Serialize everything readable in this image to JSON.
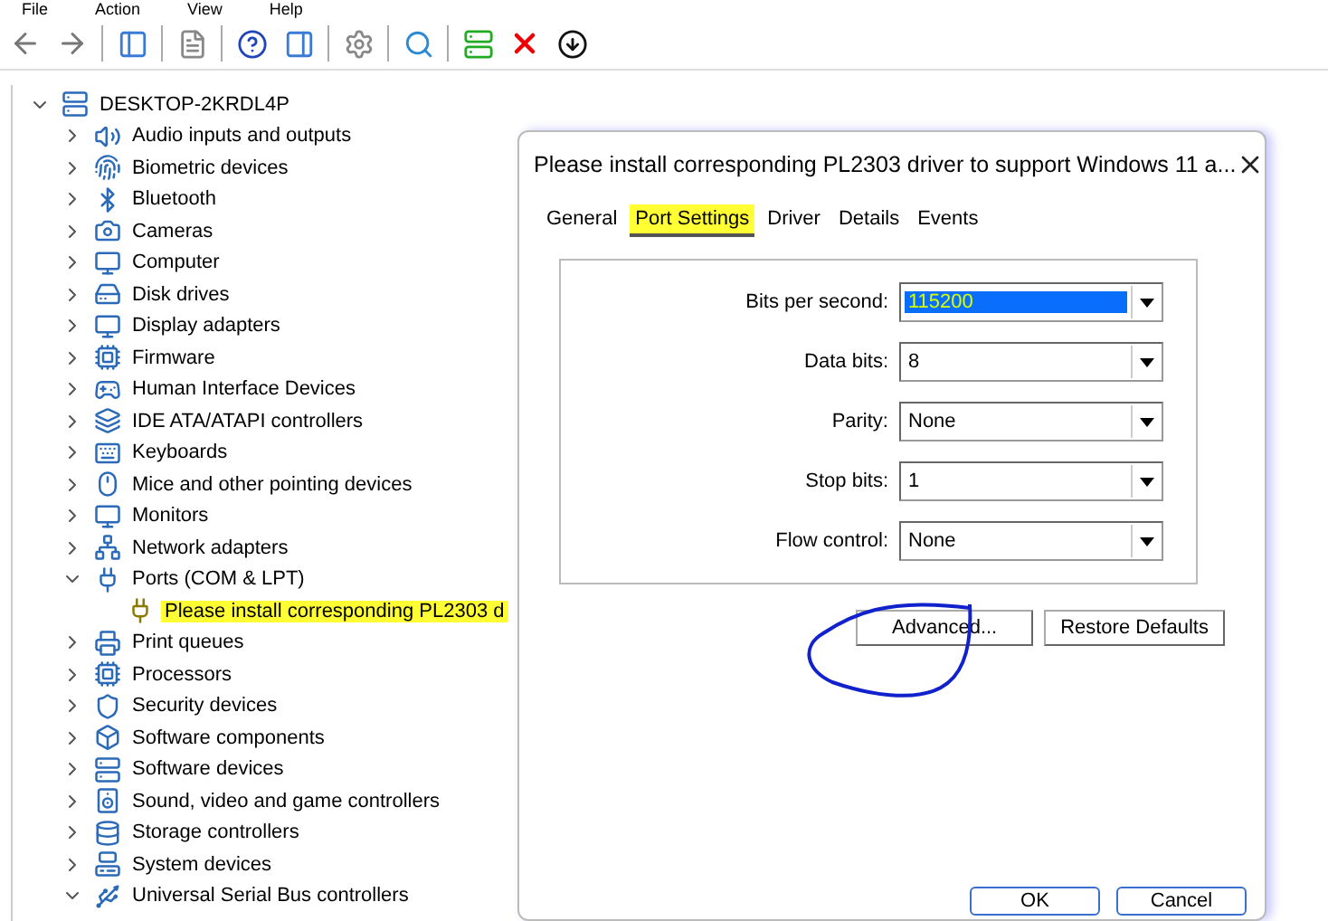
{
  "menu_bar": [
    "File",
    "Action",
    "View",
    "Help"
  ],
  "tree": {
    "label": "DESKTOP-2KRDL4P",
    "expanded": true,
    "children": [
      {
        "label": "Audio inputs and outputs",
        "expanded": false
      },
      {
        "label": "Biometric devices",
        "expanded": false
      },
      {
        "label": "Bluetooth",
        "expanded": false
      },
      {
        "label": "Cameras",
        "expanded": false
      },
      {
        "label": "Computer",
        "expanded": false
      },
      {
        "label": "Disk drives",
        "expanded": false
      },
      {
        "label": "Display adapters",
        "expanded": false
      },
      {
        "label": "Firmware",
        "expanded": false
      },
      {
        "label": "Human Interface Devices",
        "expanded": false
      },
      {
        "label": "IDE ATA/ATAPI controllers",
        "expanded": false
      },
      {
        "label": "Keyboards",
        "expanded": false
      },
      {
        "label": "Mice and other pointing devices",
        "expanded": false
      },
      {
        "label": "Monitors",
        "expanded": false
      },
      {
        "label": "Network adapters",
        "expanded": false
      },
      {
        "label": "Ports (COM & LPT)",
        "expanded": true,
        "children": [
          {
            "label": "Please install corresponding PL2303 d",
            "highlighted": true
          }
        ]
      },
      {
        "label": "Print queues",
        "expanded": false
      },
      {
        "label": "Processors",
        "expanded": false
      },
      {
        "label": "Security devices",
        "expanded": false
      },
      {
        "label": "Software components",
        "expanded": false
      },
      {
        "label": "Software devices",
        "expanded": false
      },
      {
        "label": "Sound, video and game controllers",
        "expanded": false
      },
      {
        "label": "Storage controllers",
        "expanded": false
      },
      {
        "label": "System devices",
        "expanded": false
      },
      {
        "label": "Universal Serial Bus controllers",
        "expanded": true
      }
    ]
  },
  "dialog": {
    "title": "Please install corresponding PL2303 driver to support Windows 11 a...",
    "tabs": [
      {
        "label": "General",
        "selected": false,
        "highlighted": false
      },
      {
        "label": "Port Settings",
        "selected": true,
        "highlighted": true
      },
      {
        "label": "Driver",
        "selected": false,
        "highlighted": false
      },
      {
        "label": "Details",
        "selected": false,
        "highlighted": false
      },
      {
        "label": "Events",
        "selected": false,
        "highlighted": false
      }
    ],
    "fields": [
      {
        "label": "Bits per second:",
        "value": "115200",
        "selected": true
      },
      {
        "label": "Data bits:",
        "value": "8",
        "selected": false
      },
      {
        "label": "Parity:",
        "value": "None",
        "selected": false
      },
      {
        "label": "Stop bits:",
        "value": "1",
        "selected": false
      },
      {
        "label": "Flow control:",
        "value": "None",
        "selected": false
      }
    ],
    "buttons": [
      "Advanced...",
      "Restore Defaults"
    ],
    "footer_buttons": [
      "OK",
      "Cancel"
    ]
  }
}
